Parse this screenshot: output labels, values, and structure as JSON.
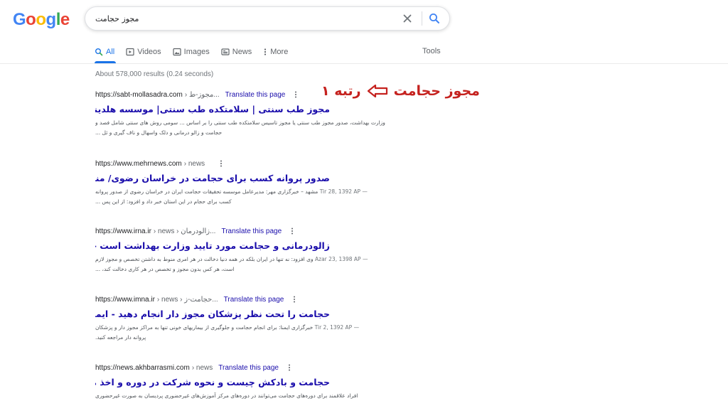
{
  "logo": {
    "letters": [
      "G",
      "o",
      "o",
      "g",
      "l",
      "e"
    ],
    "colors": [
      "#4285f4",
      "#ea4335",
      "#fbbc05",
      "#4285f4",
      "#34a853",
      "#ea4335"
    ]
  },
  "search": {
    "query": "مجوز حجامت",
    "clear_icon": "close-icon",
    "search_icon": "search-icon"
  },
  "tabs": [
    {
      "label": "All",
      "icon": "search-icon",
      "active": true
    },
    {
      "label": "Videos",
      "icon": "video-icon",
      "active": false
    },
    {
      "label": "Images",
      "icon": "image-icon",
      "active": false
    },
    {
      "label": "News",
      "icon": "news-icon",
      "active": false
    },
    {
      "label": "More",
      "icon": "more-vert-icon",
      "active": false
    }
  ],
  "tools_label": "Tools",
  "stats": "About 578,000 results (0.24 seconds)",
  "annotation": {
    "text": "مجوز حجامت",
    "rank": "رتبه ۱",
    "color": "#c5221f"
  },
  "results": [
    {
      "url": "https://sabt-mollasadra.com",
      "path": "› مجوز-ط...",
      "translate": "Translate this page",
      "title": "مجوز طب سنتی | سلامتکده طب سنتی| موسسه هلدینگ ملاصدرا",
      "snippet": [
        {
          "date": "",
          "text": "وزارت بهداشت، صدور مجوز طب سنتی یا مجوز تاسیس سلامتکده طب سنتی را بر اساس ... سومی روش های سنتی شامل فصد و"
        },
        {
          "date": "",
          "text": "حجامت و زالو درمانی و دلک واسهال و ناف گیری و ثل ..."
        }
      ]
    },
    {
      "url": "https://www.mehrnews.com",
      "path": "› news",
      "translate": "",
      "title": "صدور پروانه کسب برای حجامت در خراسان رضوی/ منشور اخلاقی ...",
      "snippet": [
        {
          "date": "Tir 28, 1392 AP —",
          "text": "مشهد – خبرگزاری مهر: مدیرعامل موسسه تحقیقات حجامت ایران در خراسان رضوی از صدور پروانه"
        },
        {
          "date": "",
          "text": "کسب برای حجام در این استان خبر داد و افزود: از این پس ..."
        }
      ]
    },
    {
      "url": "https://www.irna.ir",
      "path": "› news › زالودرمان...",
      "translate": "Translate this page",
      "title": "زالودرمانی و حجامت مورد تایید وزارت بهداشت است - ایرنا",
      "snippet": [
        {
          "date": "Azar 23, 1398 AP —",
          "text": "وی افزود: نه تنها در ایران بلکه در همه دنیا دخالت در هر امری منوط به داشتن تخصص و مجوز لازم"
        },
        {
          "date": "",
          "text": "است، هر کس بدون مجوز و تخصص در هر کاری دخالت کند، ..."
        }
      ]
    },
    {
      "url": "https://www.imna.ir",
      "path": "› news › حجامت-ز...",
      "translate": "Translate this page",
      "title": "حجامت را تحت نظر پزشکان مجوز دار انجام دهید - ایمنا",
      "snippet": [
        {
          "date": "Tir 2, 1392 AP —",
          "text": "خبرگزاری ایمنا: برای انجام حجامت و جلوگیری از بیماریهای خونی تنها به مراکز مجوز دار و پزشکان"
        },
        {
          "date": "",
          "text": "پروانه دار مراجعه کنید."
        }
      ]
    },
    {
      "url": "https://news.akhbarrasmi.com",
      "path": "› news",
      "translate": "Translate this page",
      "title": "حجامت و بادکش چیست و نحوه شرکت در دوره و اخذ مدرک حجامت و بادکش",
      "snippet": [
        {
          "date": "",
          "text": "افراد علاقمند برای دوره‌های حجامت می‌توانند در دوره‌های مرکز آموزش‌های غیرحضوری پردیسان به صورت غیرحضوری"
        }
      ]
    }
  ]
}
